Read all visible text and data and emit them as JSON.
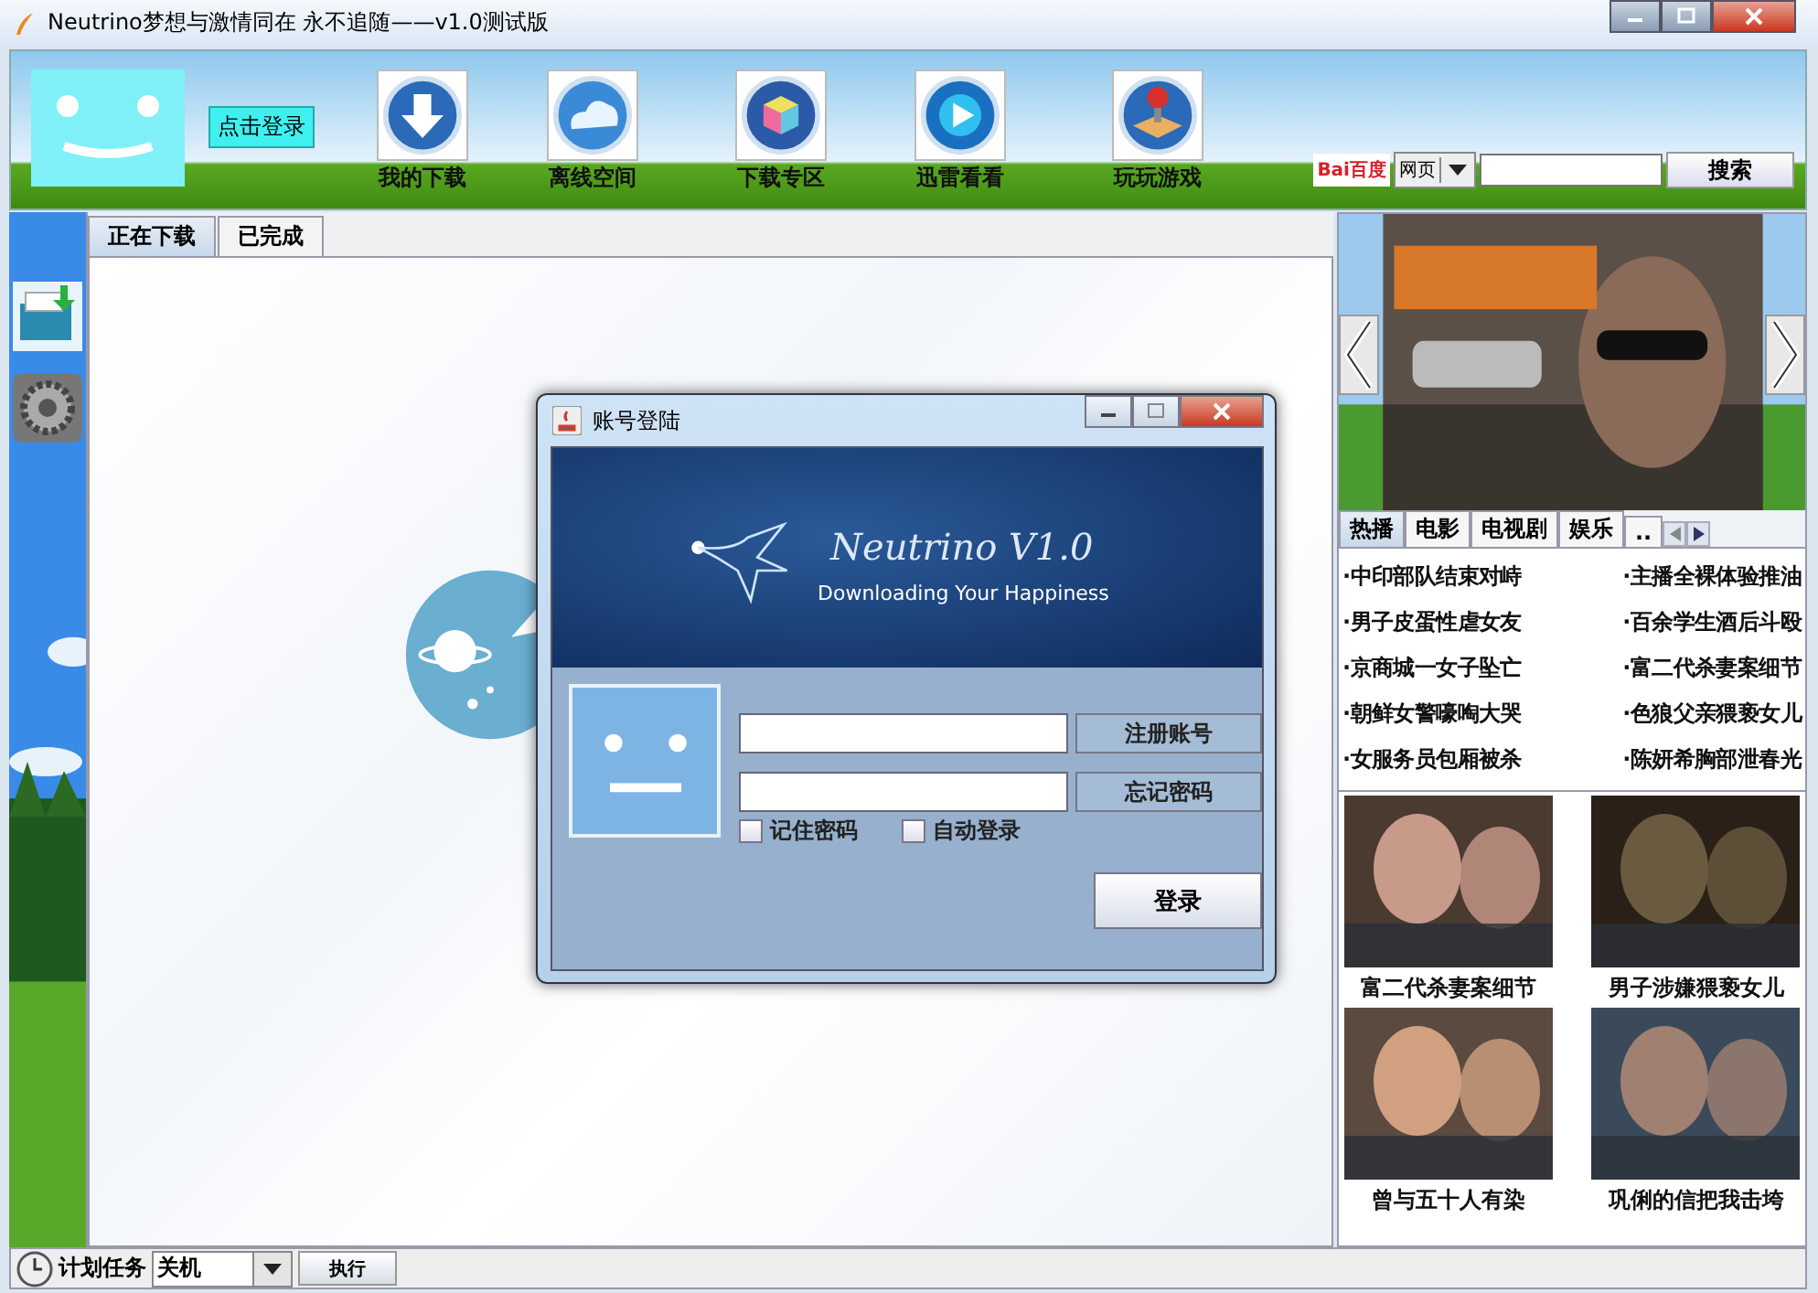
{
  "window": {
    "title": "Neutrino梦想与激情同在  永不追随——v1.0测试版"
  },
  "header": {
    "login_link": "点击登录",
    "nav": [
      {
        "label": "我的下载",
        "kind": "download"
      },
      {
        "label": "离线空间",
        "kind": "cloud"
      },
      {
        "label": "下载专区",
        "kind": "cube"
      },
      {
        "label": "迅雷看看",
        "kind": "play"
      },
      {
        "label": "玩玩游戏",
        "kind": "game"
      }
    ],
    "search": {
      "logo": "Bai百度",
      "engine": "网页",
      "button": "搜索"
    }
  },
  "tabs": [
    {
      "label": "正在下载",
      "selected": true
    },
    {
      "label": "已完成",
      "selected": false
    }
  ],
  "right_panel": {
    "news_tabs": [
      {
        "label": "热播",
        "selected": true
      },
      {
        "label": "电影",
        "selected": false
      },
      {
        "label": "电视剧",
        "selected": false
      },
      {
        "label": "娱乐",
        "selected": false
      },
      {
        "label": "..",
        "selected": false
      }
    ],
    "headlines": [
      "·中印部队结束对峙",
      "·主播全裸体验推油",
      "·男子皮蛋性虐女友",
      "·百余学生酒后斗殴",
      "·京商城一女子坠亡",
      "·富二代杀妻案细节",
      "·朝鲜女警嚎啕大哭",
      "·色狼父亲猥亵女儿",
      "·女服务员包厢被杀",
      "·陈妍希胸部泄春光"
    ],
    "photos": [
      {
        "caption": "富二代杀妻案细节"
      },
      {
        "caption": "男子涉嫌猥亵女儿"
      },
      {
        "caption": "曾与五十人有染"
      },
      {
        "caption": "巩俐的信把我击垮"
      }
    ]
  },
  "bottom_bar": {
    "label": "计划任务",
    "action": "关机",
    "button": "执行"
  },
  "dialog": {
    "title": "账号登陆",
    "banner_title": "Neutrino V1.0",
    "banner_subtitle": "Downloading Your Happiness",
    "register": "注册账号",
    "forgot": "忘记密码",
    "checkboxes": [
      {
        "label": "记住密码",
        "checked": false
      },
      {
        "label": "自动登录",
        "checked": false
      }
    ],
    "login": "登录"
  }
}
